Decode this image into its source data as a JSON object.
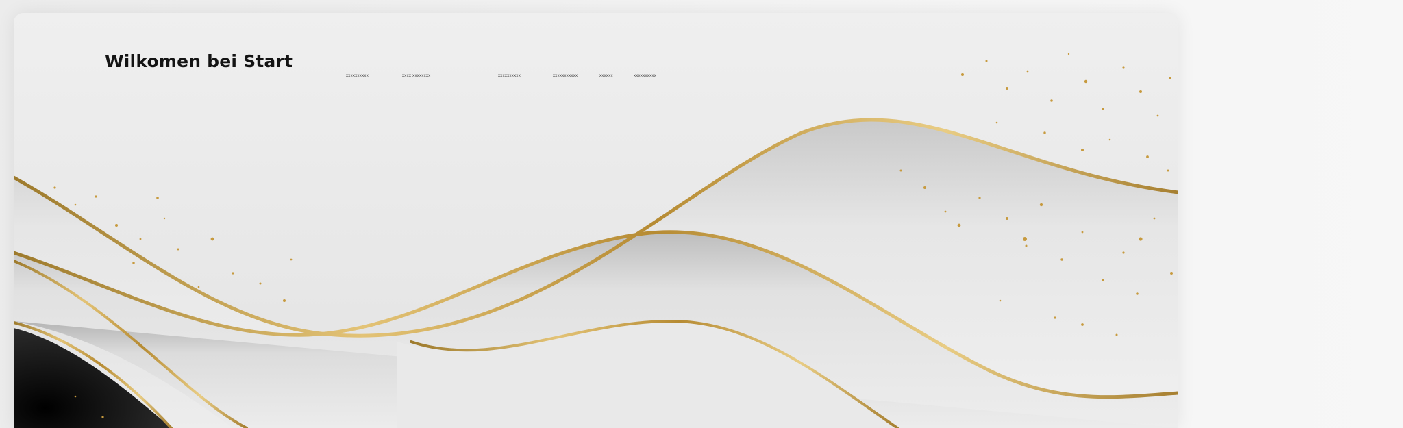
{
  "header": {
    "title": "Wilkomen bei Start"
  },
  "nav": {
    "items": [
      {
        "label": "xxxxxxxxxx"
      },
      {
        "label": "xxxx xxxxxxxx"
      },
      {
        "label": "xxxxxxxxxx"
      },
      {
        "label": "xxxxxxxxxxx"
      },
      {
        "label": "xxxxxx"
      },
      {
        "label": "xxxxxxxxxx"
      }
    ]
  },
  "colors": {
    "background": "#eaeaea",
    "gold": "#c9a24a",
    "dark": "#151515",
    "title": "#141414"
  }
}
